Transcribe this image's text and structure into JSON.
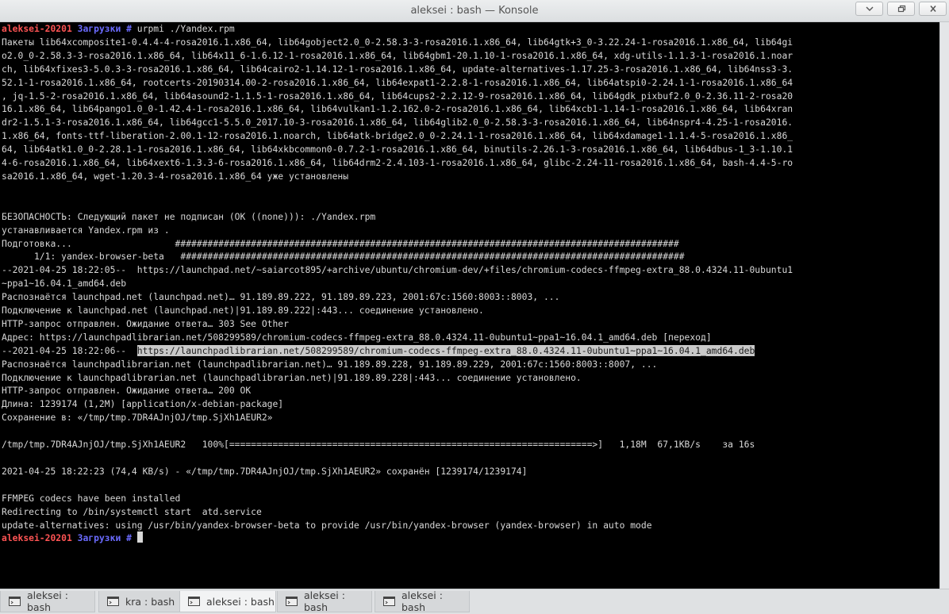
{
  "window": {
    "title": "aleksei : bash — Konsole"
  },
  "tabs": [
    {
      "label": "aleksei : bash"
    },
    {
      "label": "kra : bash"
    },
    {
      "label": "aleksei : bash"
    },
    {
      "label": "aleksei : bash"
    },
    {
      "label": "aleksei : bash"
    }
  ],
  "prompt": {
    "user_host": "aleksei-20201",
    "dir": "Загрузки",
    "symbol": "#"
  },
  "command": " urpmi ./Yandex.rpm",
  "output_block_1": "Пакеты lib64xcomposite1-0.4.4-4-rosa2016.1.x86_64, lib64gobject2.0_0-2.58.3-3-rosa2016.1.x86_64, lib64gtk+3_0-3.22.24-1-rosa2016.1.x86_64, lib64gi\no2.0_0-2.58.3-3-rosa2016.1.x86_64, lib64x11_6-1.6.12-1-rosa2016.1.x86_64, lib64gbm1-20.1.10-1-rosa2016.1.x86_64, xdg-utils-1.1.3-1-rosa2016.1.noar\nch, lib64xfixes3-5.0.3-3-rosa2016.1.x86_64, lib64cairo2-1.14.12-1-rosa2016.1.x86_64, update-alternatives-1.17.25-3-rosa2016.1.x86_64, lib64nss3-3.\n52.1-1-rosa2016.1.x86_64, rootcerts-20190314.00-2-rosa2016.1.x86_64, lib64expat1-2.2.8-1-rosa2016.1.x86_64, lib64atspi0-2.24.1-1-rosa2016.1.x86_64\n, jq-1.5-2-rosa2016.1.x86_64, lib64asound2-1.1.5-1-rosa2016.1.x86_64, lib64cups2-2.2.12-9-rosa2016.1.x86_64, lib64gdk_pixbuf2.0_0-2.36.11-2-rosa20\n16.1.x86_64, lib64pango1.0_0-1.42.4-1-rosa2016.1.x86_64, lib64vulkan1-1.2.162.0-2-rosa2016.1.x86_64, lib64xcb1-1.14-1-rosa2016.1.x86_64, lib64xran\ndr2-1.5.1-3-rosa2016.1.x86_64, lib64gcc1-5.5.0_2017.10-3-rosa2016.1.x86_64, lib64glib2.0_0-2.58.3-3-rosa2016.1.x86_64, lib64nspr4-4.25-1-rosa2016.\n1.x86_64, fonts-ttf-liberation-2.00.1-12-rosa2016.1.noarch, lib64atk-bridge2.0_0-2.24.1-1-rosa2016.1.x86_64, lib64xdamage1-1.1.4-5-rosa2016.1.x86_\n64, lib64atk1.0_0-2.28.1-1-rosa2016.1.x86_64, lib64xkbcommon0-0.7.2-1-rosa2016.1.x86_64, binutils-2.26.1-3-rosa2016.1.x86_64, lib64dbus-1_3-1.10.1\n4-6-rosa2016.1.x86_64, lib64xext6-1.3.3-6-rosa2016.1.x86_64, lib64drm2-2.4.103-1-rosa2016.1.x86_64, glibc-2.24-11-rosa2016.1.x86_64, bash-4.4-5-ro\nsa2016.1.x86_64, wget-1.20.3-4-rosa2016.1.x86_64 уже установлены\n\n\nБЕЗОПАСНОСТЬ: Следующий пакет не подписан (OK ((none))): ./Yandex.rpm\nустанавливается Yandex.rpm из .\nПодготовка...                   #############################################################################################\n      1/1: yandex-browser-beta   #############################################################################################\n--2021-04-25 18:22:05--  https://launchpad.net/~saiarcot895/+archive/ubuntu/chromium-dev/+files/chromium-codecs-ffmpeg-extra_88.0.4324.11-0ubuntu1\n~ppa1~16.04.1_amd64.deb\nРаспознаётся launchpad.net (launchpad.net)… 91.189.89.222, 91.189.89.223, 2001:67c:1560:8003::8003, ...\nПодключение к launchpad.net (launchpad.net)|91.189.89.222|:443... соединение установлено.\nHTTP-запрос отправлен. Ожидание ответа… 303 See Other\nАдрес: https://launchpadlibrarian.net/508299589/chromium-codecs-ffmpeg-extra_88.0.4324.11-0ubuntu1~ppa1~16.04.1_amd64.deb [переход]",
  "redirect_prefix": "--2021-04-25 18:22:06--  ",
  "selected_url": "https://launchpadlibrarian.net/508299589/chromium-codecs-ffmpeg-extra_88.0.4324.11-0ubuntu1~ppa1~16.04.1_amd64.deb",
  "output_block_2": "Распознаётся launchpadlibrarian.net (launchpadlibrarian.net)… 91.189.89.228, 91.189.89.229, 2001:67c:1560:8003::8007, ...\nПодключение к launchpadlibrarian.net (launchpadlibrarian.net)|91.189.89.228|:443... соединение установлено.\nHTTP-запрос отправлен. Ожидание ответа… 200 OK\nДлина: 1239174 (1,2M) [application/x-debian-package]\nСохранение в: «/tmp/tmp.7DR4AJnjOJ/tmp.SjXh1AEUR2»\n\n/tmp/tmp.7DR4AJnjOJ/tmp.SjXh1AEUR2   100%[===================================================================>]   1,18M  67,1KB/s    за 16s\n\n2021-04-25 18:22:23 (74,4 KB/s) - «/tmp/tmp.7DR4AJnjOJ/tmp.SjXh1AEUR2» сохранён [1239174/1239174]\n\nFFMPEG codecs have been installed\nRedirecting to /bin/systemctl start  atd.service\nupdate-alternatives: using /usr/bin/yandex-browser-beta to provide /usr/bin/yandex-browser (yandex-browser) in auto mode"
}
